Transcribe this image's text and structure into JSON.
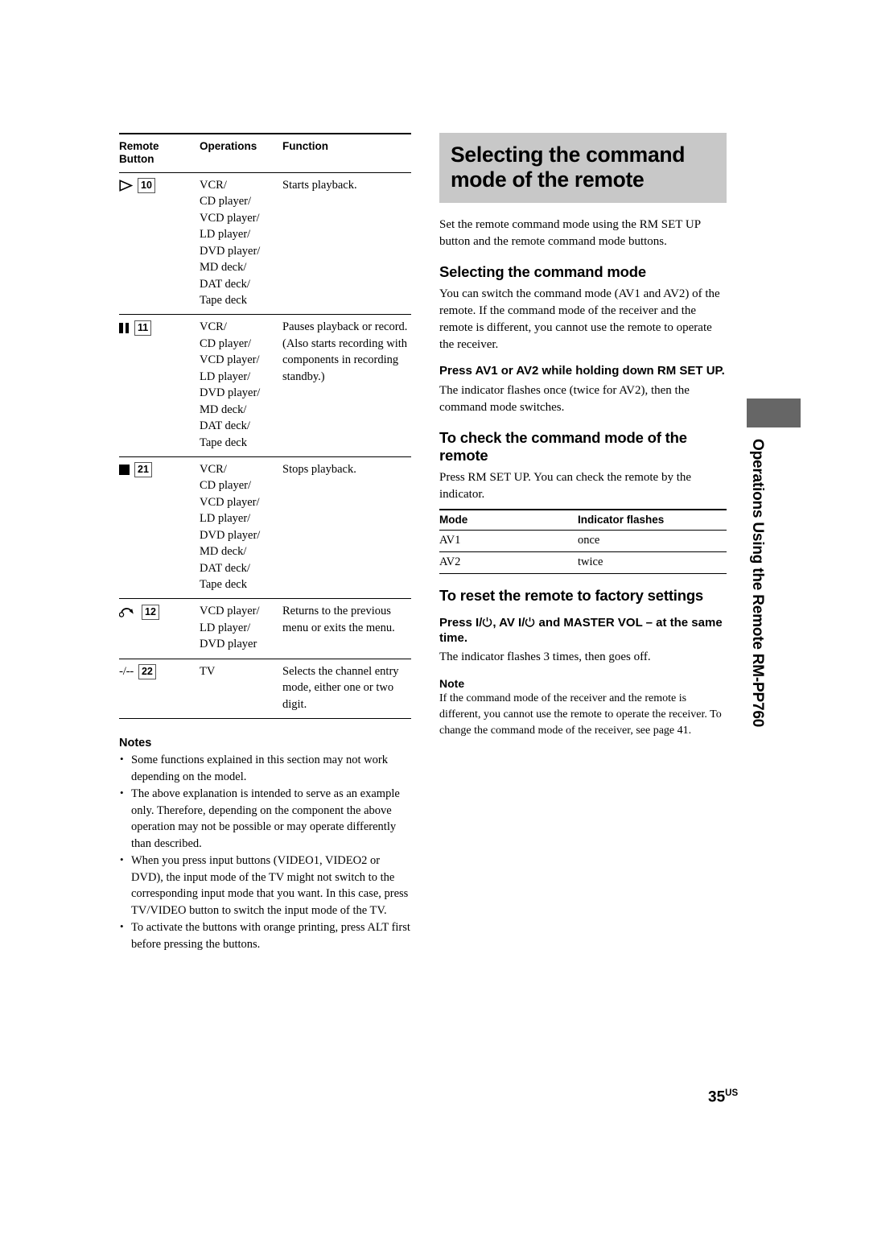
{
  "left": {
    "table": {
      "headers": [
        "Remote Button",
        "Operations",
        "Function"
      ],
      "header_button": "Remote",
      "header_button2": "Button",
      "header_operations": "Operations",
      "header_function": "Function",
      "rows": [
        {
          "icon": "play-icon",
          "number": "10",
          "operations": "VCR/\nCD player/\nVCD player/\nLD player/\nDVD player/\nMD deck/\nDAT deck/\nTape deck",
          "function": "Starts playback."
        },
        {
          "icon": "pause-icon",
          "number": "11",
          "operations": "VCR/\nCD player/\nVCD player/\nLD player/\nDVD player/\nMD deck/\nDAT deck/\nTape deck",
          "function": "Pauses playback or record. (Also starts recording with components in recording standby.)"
        },
        {
          "icon": "stop-icon",
          "number": "21",
          "operations": "VCR/\nCD player/\nVCD player/\nLD player/\nDVD player/\nMD deck/\nDAT deck/\nTape deck",
          "function": "Stops playback."
        },
        {
          "icon": "return-icon",
          "number": "12",
          "operations": "VCD player/\nLD player/\nDVD player",
          "function": "Returns to the previous menu or exits the menu."
        },
        {
          "icon": "dash-label",
          "dash_label": "-/--",
          "number": "22",
          "operations": "TV",
          "function": "Selects the channel entry mode, either one or two digit."
        }
      ]
    },
    "notes": {
      "title": "Notes",
      "items": [
        "Some functions explained in this section may not work depending on the model.",
        "The above explanation is intended to serve as an example only. Therefore, depending on the component the above operation may not be possible or may operate differently than described.",
        "When you press input buttons (VIDEO1, VIDEO2 or DVD), the input mode of the TV might not switch to the corresponding input mode that you want. In this case, press TV/VIDEO button to switch the input mode of the TV.",
        "To activate the buttons with orange printing, press ALT first before pressing the buttons."
      ]
    }
  },
  "right": {
    "banner_title": "Selecting the command mode of the remote",
    "intro": "Set the remote command mode using the RM SET UP button and the remote command mode buttons.",
    "section1": {
      "heading": "Selecting the command mode",
      "body": "You can switch the command mode (AV1 and AV2) of the remote. If the command mode of the receiver and the remote is different, you cannot use the remote to operate the receiver.",
      "instruction": "Press AV1 or AV2 while holding down RM SET UP.",
      "result": "The indicator flashes once (twice for AV2), then the command mode switches."
    },
    "section2": {
      "heading": "To check the command mode of the remote",
      "body": "Press RM SET UP. You can check the remote by the indicator.",
      "table": {
        "headers": [
          "Mode",
          "Indicator flashes"
        ],
        "rows": [
          [
            "AV1",
            "once"
          ],
          [
            "AV2",
            "twice"
          ]
        ]
      }
    },
    "section3": {
      "heading": "To reset the remote to factory settings",
      "instruction_pre": "Press I/",
      "instruction_mid": ", AV I/",
      "instruction_post": " and MASTER VOL – at the same time.",
      "result": "The indicator flashes 3 times, then goes off.",
      "note_title": "Note",
      "note_body": "If the command mode of the receiver and the remote is different, you cannot use the remote to operate the receiver. To change the command mode of the receiver, see page 41."
    }
  },
  "side_tab": {
    "label": "Operations Using the Remote RM-PP760"
  },
  "page_number": {
    "number": "35",
    "region": "US"
  },
  "colors": {
    "banner_bg": "#c8c8c8",
    "side_tab_marker": "#666666",
    "text": "#000000"
  }
}
